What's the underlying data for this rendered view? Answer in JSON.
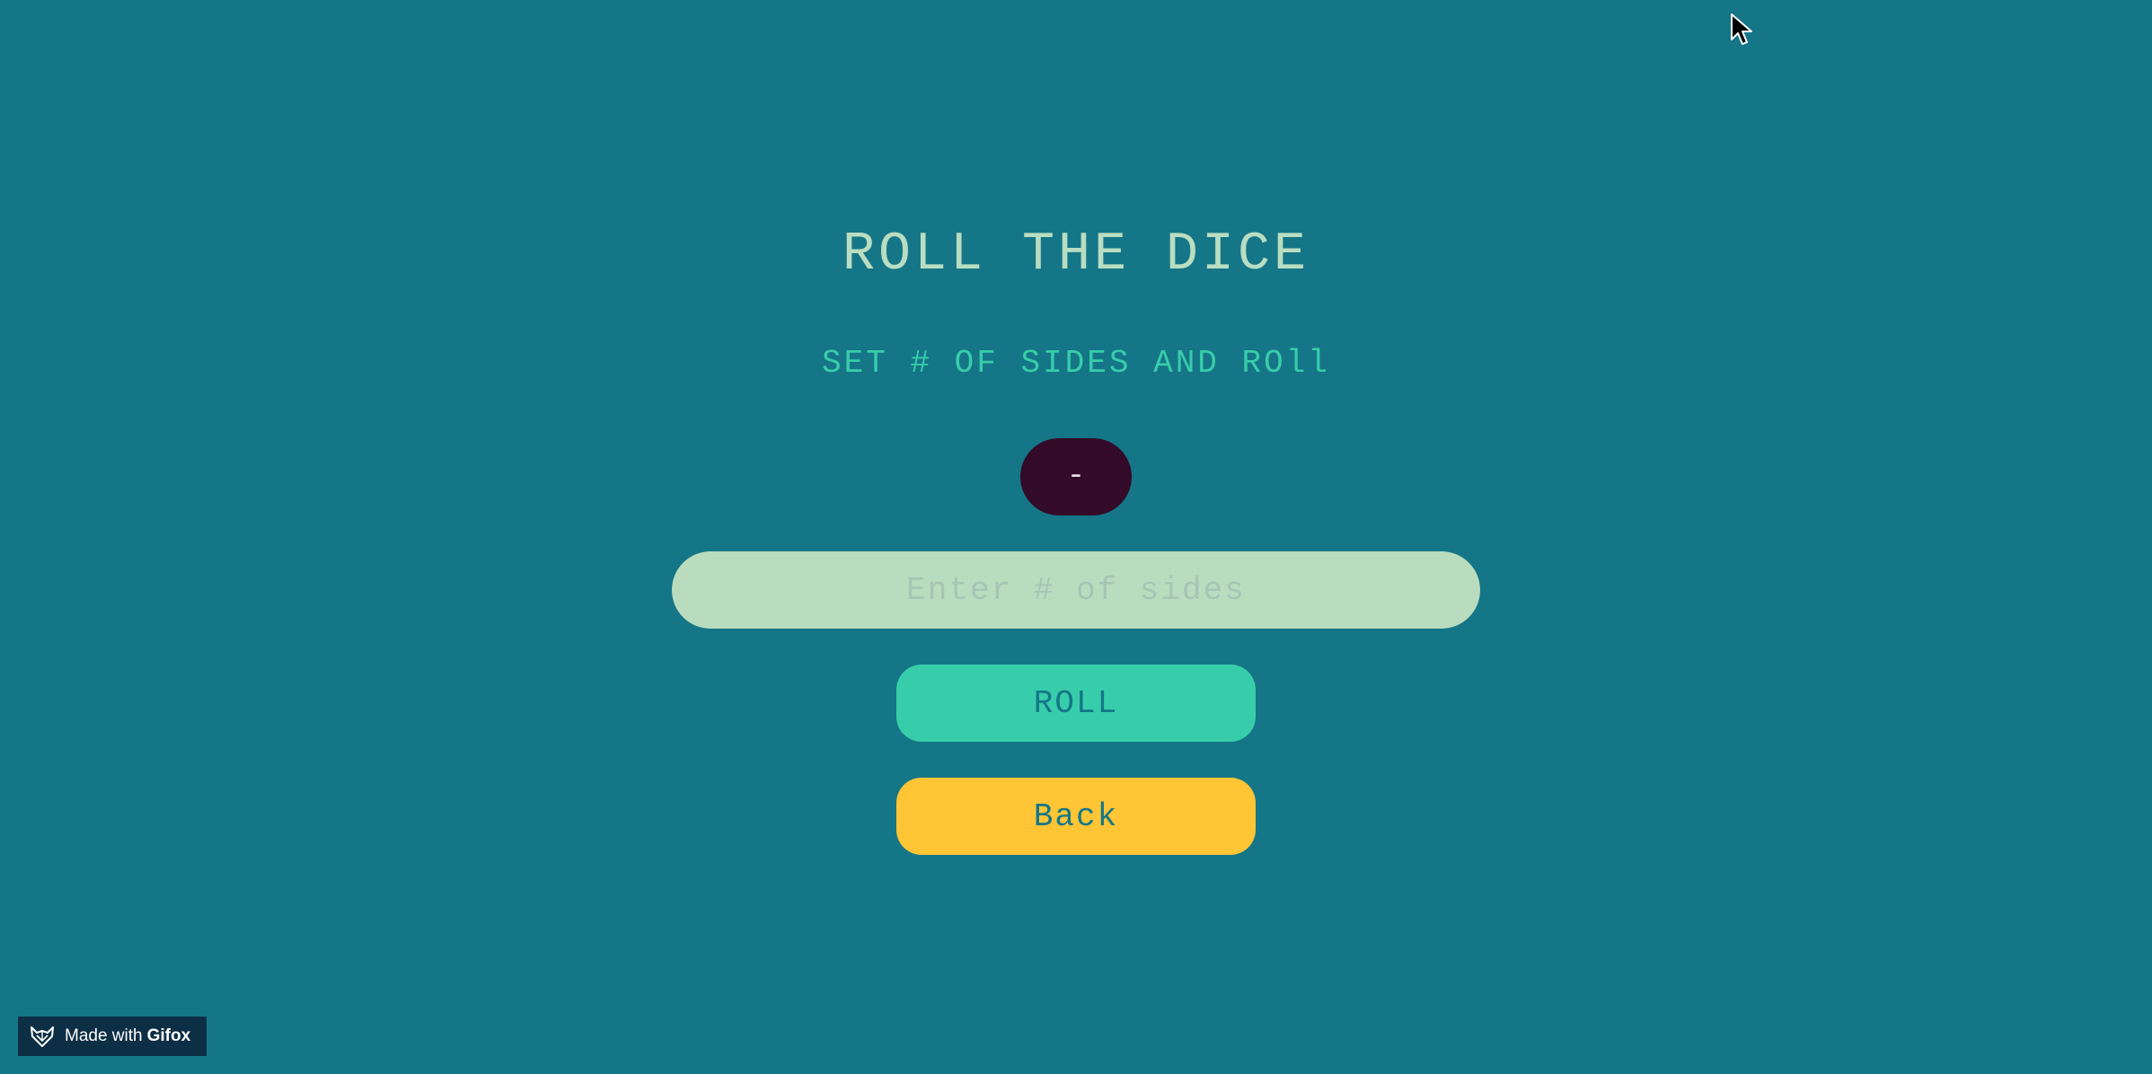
{
  "page": {
    "title": "ROLL THE DICE",
    "subtitle": "SET # OF SIDES AND ROll",
    "result": "-"
  },
  "input": {
    "placeholder": "Enter # of sides",
    "value": ""
  },
  "buttons": {
    "roll_label": "ROLL",
    "back_label": "Back"
  },
  "badge": {
    "prefix": "Made with",
    "brand": "Gifox",
    "icon": "fox-icon"
  },
  "colors": {
    "background": "#157687",
    "title": "#b9ddc1",
    "subtitle": "#38cdaa",
    "result_bg": "#330a27",
    "input_bg": "#b9dcbf",
    "roll_bg": "#38cdaa",
    "back_bg": "#ffc535"
  },
  "pointer": {
    "icon": "mouse-cursor-icon"
  }
}
